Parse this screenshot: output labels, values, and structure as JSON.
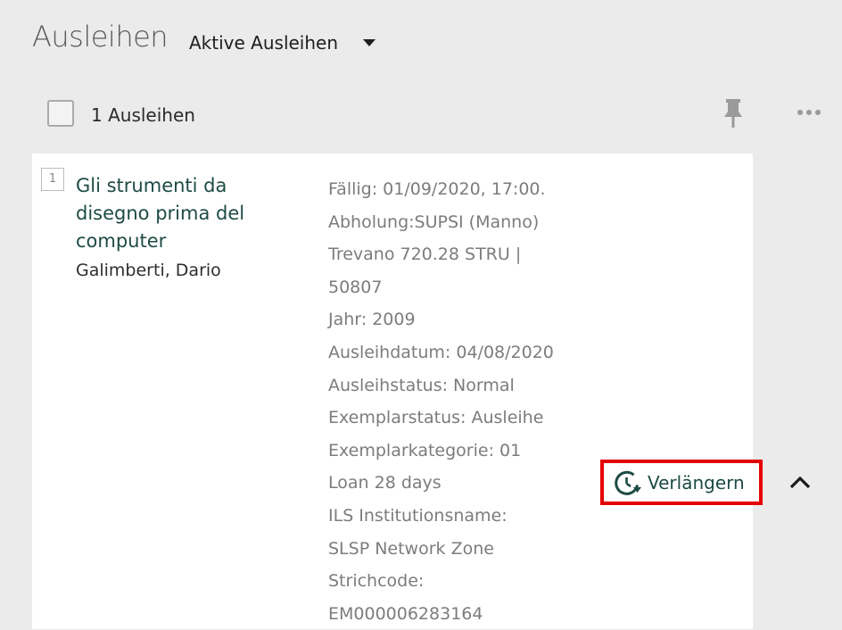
{
  "header": {
    "title": "Ausleihen",
    "filter_label": "Aktive Ausleihen"
  },
  "toolbar": {
    "count_label": "1 Ausleihen"
  },
  "loan": {
    "number": "1",
    "title": "Gli strumenti da disegno prima del computer",
    "author": "Galimberti, Dario",
    "details": [
      "Fällig: 01/09/2020, 17:00.",
      "Abholung:SUPSI (Manno)",
      "Trevano 720.28 STRU |",
      "50807",
      "Jahr: 2009",
      "Ausleihdatum: 04/08/2020",
      "Ausleihstatus: Normal",
      "Exemplarstatus: Ausleihe",
      "Exemplarkategorie: 01",
      "Loan 28 days",
      "ILS Institutionsname:",
      "SLSP Network Zone",
      "Strichcode:",
      "EM000006283164"
    ],
    "renew_label": "Verlängern"
  },
  "colors": {
    "background": "#ebebeb",
    "card": "#ffffff",
    "title_green": "#1d4b44",
    "highlight_red": "#e50000",
    "detail_gray": "#7c7c7c"
  },
  "icons": {
    "filter_caret": "caret-down-icon",
    "pin": "pin-icon",
    "more": "more-horizontal-icon",
    "renew": "renew-clock-icon",
    "collapse": "chevron-up-icon"
  }
}
